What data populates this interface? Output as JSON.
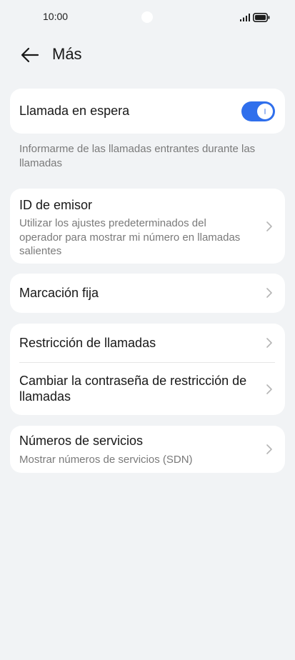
{
  "status_bar": {
    "time": "10:00"
  },
  "header": {
    "title": "Más",
    "back_icon": "arrow-left-icon"
  },
  "call_waiting": {
    "label": "Llamada en espera",
    "enabled": true,
    "caption": "Informarme de las llamadas entrantes durante las llamadas"
  },
  "caller_id": {
    "label": "ID de emisor",
    "subtitle": "Utilizar los ajustes predeterminados del operador para mostrar mi número en llamadas salientes"
  },
  "fixed_dialing": {
    "label": "Marcación fija"
  },
  "call_barring": {
    "items": [
      {
        "label": "Restricción de llamadas"
      },
      {
        "label": "Cambiar la contraseña de restricción de llamadas"
      }
    ]
  },
  "service_numbers": {
    "label": "Números de servicios",
    "subtitle": "Mostrar números de servicios (SDN)"
  },
  "colors": {
    "background": "#f1f3f5",
    "card": "#ffffff",
    "accent": "#2f6fec",
    "secondary_text": "#7a7a7a"
  }
}
